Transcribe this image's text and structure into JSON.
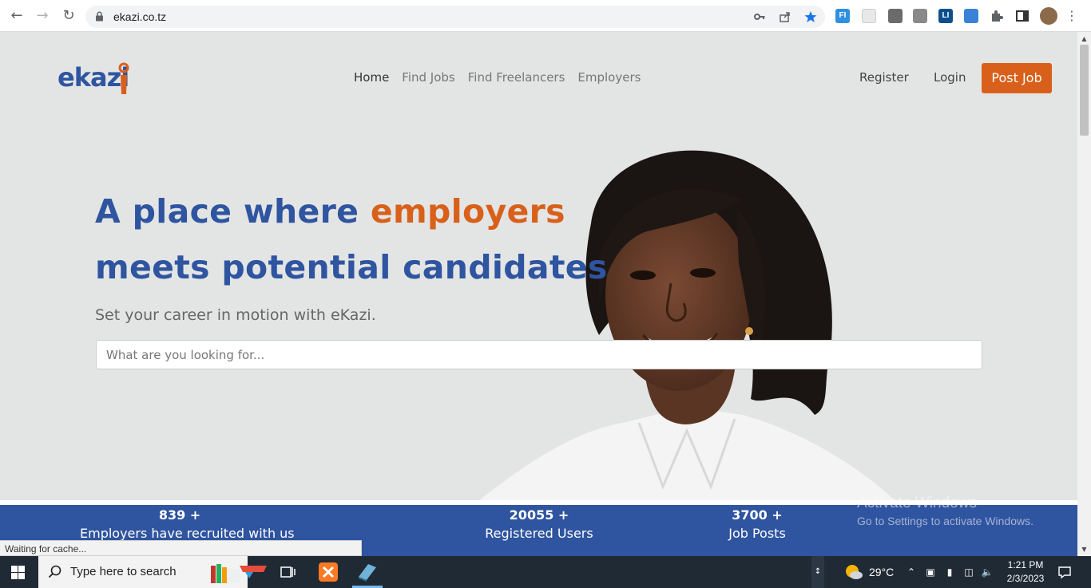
{
  "browser": {
    "url": "ekazi.co.tz",
    "status_text": "Waiting for cache..."
  },
  "site": {
    "logo_text": "ekazi",
    "nav": [
      "Home",
      "Find Jobs",
      "Find Freelancers",
      "Employers"
    ],
    "register_label": "Register",
    "login_label": "Login",
    "post_job_label": "Post Job",
    "headline_part1": "A place where ",
    "headline_accent": "employers",
    "headline_part2": "meets potential candidates",
    "subtext": "Set your career in motion with eKazi.",
    "search_placeholder": "What are you looking for...",
    "stats": [
      {
        "value": "839 +",
        "label": "Employers have recruited with us"
      },
      {
        "value": "20055 +",
        "label": "Registered Users"
      },
      {
        "value": "3700 +",
        "label": "Job Posts"
      }
    ],
    "colors": {
      "brand_blue": "#2f54a0",
      "brand_orange": "#d9601a"
    }
  },
  "windows": {
    "activate_title": "Activate Windows",
    "activate_sub": "Go to Settings to activate Windows.",
    "search_text": "Type here to search",
    "weather": "29°C",
    "time": "1:21 PM",
    "date": "2/3/2023"
  }
}
